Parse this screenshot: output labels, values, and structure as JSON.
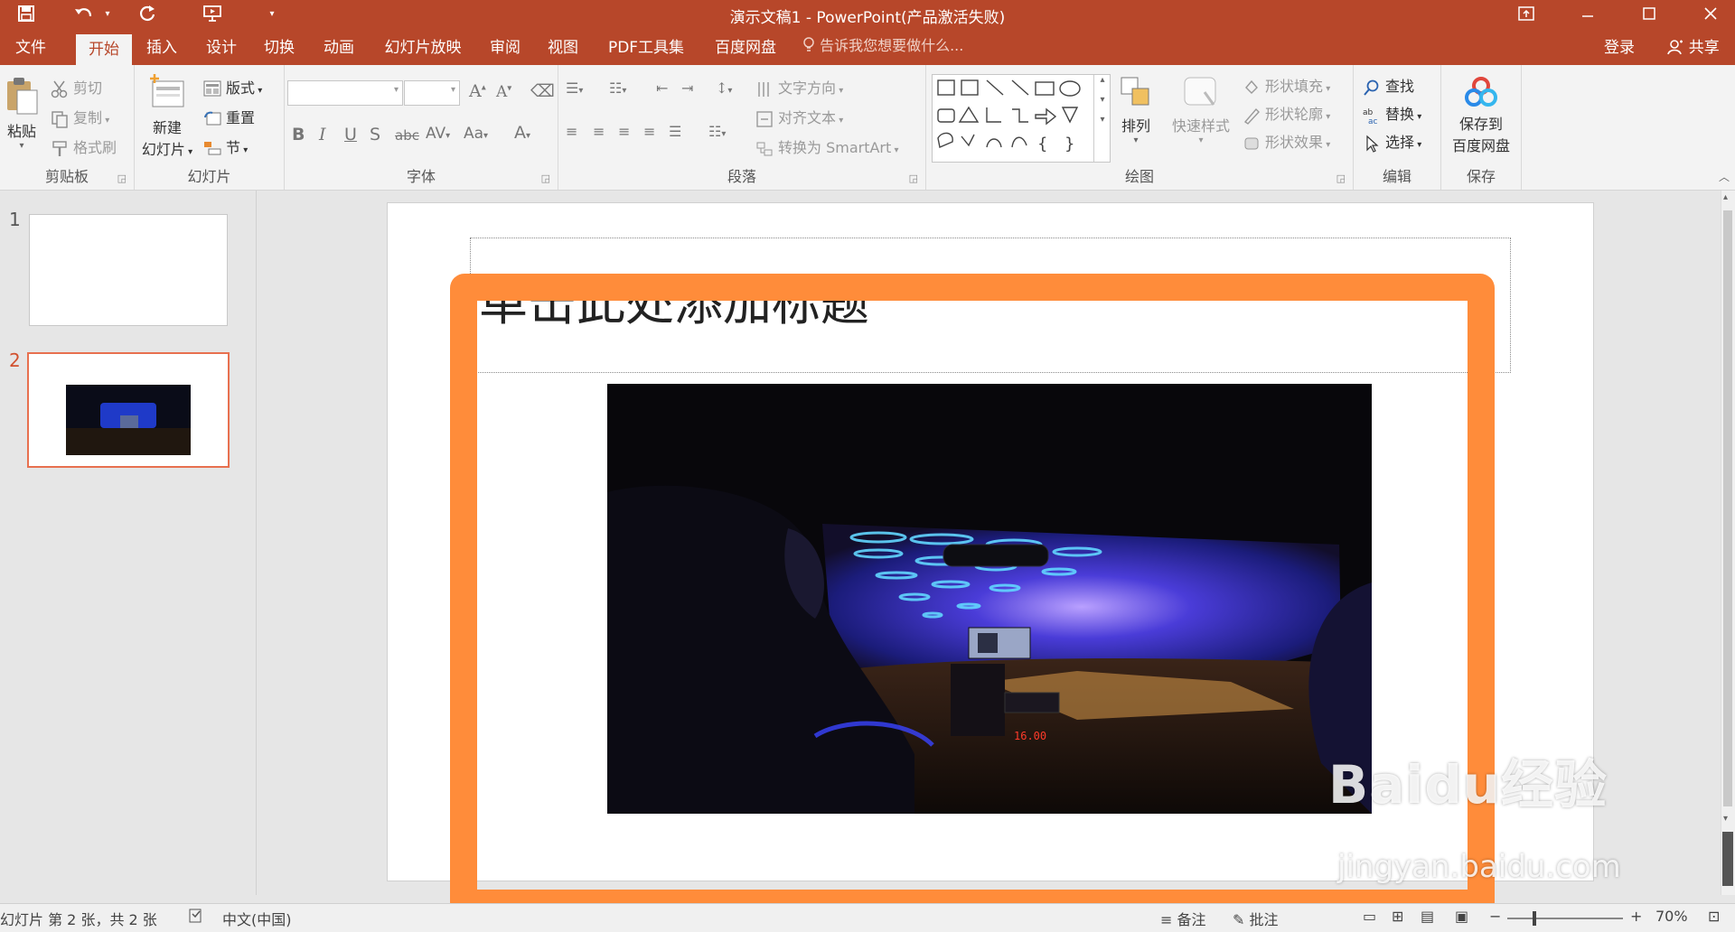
{
  "window": {
    "title": "演示文稿1 - PowerPoint(产品激活失败)",
    "login": "登录",
    "share": "共享"
  },
  "tabs": [
    {
      "label": "文件"
    },
    {
      "label": "开始"
    },
    {
      "label": "插入"
    },
    {
      "label": "设计"
    },
    {
      "label": "切换"
    },
    {
      "label": "动画"
    },
    {
      "label": "幻灯片放映"
    },
    {
      "label": "审阅"
    },
    {
      "label": "视图"
    },
    {
      "label": "PDF工具集"
    },
    {
      "label": "百度网盘"
    }
  ],
  "tell_me": "告诉我您想要做什么...",
  "ribbon": {
    "clipboard": {
      "paste": "粘贴",
      "cut": "剪切",
      "copy": "复制",
      "format_painter": "格式刷",
      "label": "剪贴板"
    },
    "slides": {
      "new_slide_1": "新建",
      "new_slide_2": "幻灯片",
      "layout": "版式",
      "reset": "重置",
      "section": "节",
      "label": "幻灯片"
    },
    "font": {
      "label": "字体"
    },
    "paragraph": {
      "text_direction": "文字方向",
      "align_text": "对齐文本",
      "smartart": "转换为 SmartArt",
      "label": "段落"
    },
    "drawing": {
      "arrange": "排列",
      "quick_styles": "快速样式",
      "shape_fill": "形状填充",
      "shape_outline": "形状轮廓",
      "shape_effects": "形状效果",
      "label": "绘图"
    },
    "editing": {
      "find": "查找",
      "replace": "替换",
      "select": "选择",
      "label": "编辑"
    },
    "save": {
      "line1": "保存到",
      "line2": "百度网盘",
      "label": "保存"
    }
  },
  "thumbnails": [
    {
      "number": "1"
    },
    {
      "number": "2"
    }
  ],
  "slide": {
    "title_placeholder": "单击此处添加标题"
  },
  "taxi_meter": "16.00",
  "status": {
    "slide_info": "幻灯片 第 2 张，共 2 张",
    "language": "中文(中国)",
    "notes": "备注",
    "comments": "批注",
    "zoom": "70%"
  },
  "watermark": {
    "brand": "Baidu经验",
    "url": "jingyan.baidu.com"
  },
  "colors": {
    "accent": "#b7472a",
    "frame": "#ff8c3a",
    "selected_thumb": "#e8704f"
  }
}
